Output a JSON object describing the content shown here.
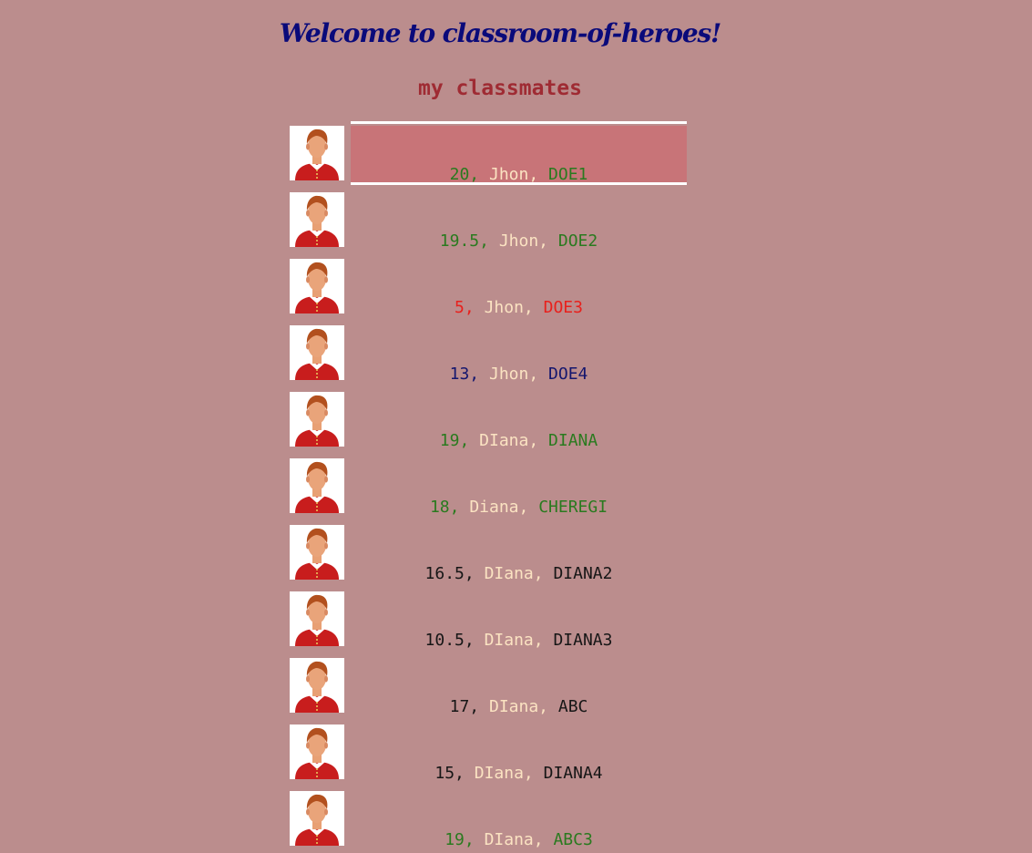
{
  "page": {
    "title": "Welcome to classroom-of-heroes!",
    "subtitle": "my classmates"
  },
  "colors": {
    "background": "#bb8d8d",
    "title": "#0a0a7a",
    "subtitle": "#9f2b33",
    "selected_row": "#c87478",
    "first_name": "#fbe3c2",
    "grade_high": "#2a7a1f",
    "grade_low": "#e8201c",
    "grade_mid": "#14166e",
    "grade_other": "#161616"
  },
  "avatar_icon": "student-avatar-icon",
  "students": [
    {
      "grade": "20",
      "first": "Jhon",
      "last": "DOE1",
      "color": "g",
      "selected": true
    },
    {
      "grade": "19.5",
      "first": "Jhon",
      "last": "DOE2",
      "color": "g"
    },
    {
      "grade": "5",
      "first": "Jhon",
      "last": "DOE3",
      "color": "r"
    },
    {
      "grade": "13",
      "first": "Jhon",
      "last": "DOE4",
      "color": "b"
    },
    {
      "grade": "19",
      "first": "DIana",
      "last": "DIANA",
      "color": "g"
    },
    {
      "grade": "18",
      "first": "Diana",
      "last": "CHEREGI",
      "color": "g"
    },
    {
      "grade": "16.5",
      "first": "DIana",
      "last": "DIANA2",
      "color": "k"
    },
    {
      "grade": "10.5",
      "first": "DIana",
      "last": "DIANA3",
      "color": "k"
    },
    {
      "grade": "17",
      "first": "DIana",
      "last": "ABC",
      "color": "k"
    },
    {
      "grade": "15",
      "first": "DIana",
      "last": "DIANA4",
      "color": "k"
    },
    {
      "grade": "19",
      "first": "DIana",
      "last": "ABC3",
      "color": "g"
    }
  ]
}
